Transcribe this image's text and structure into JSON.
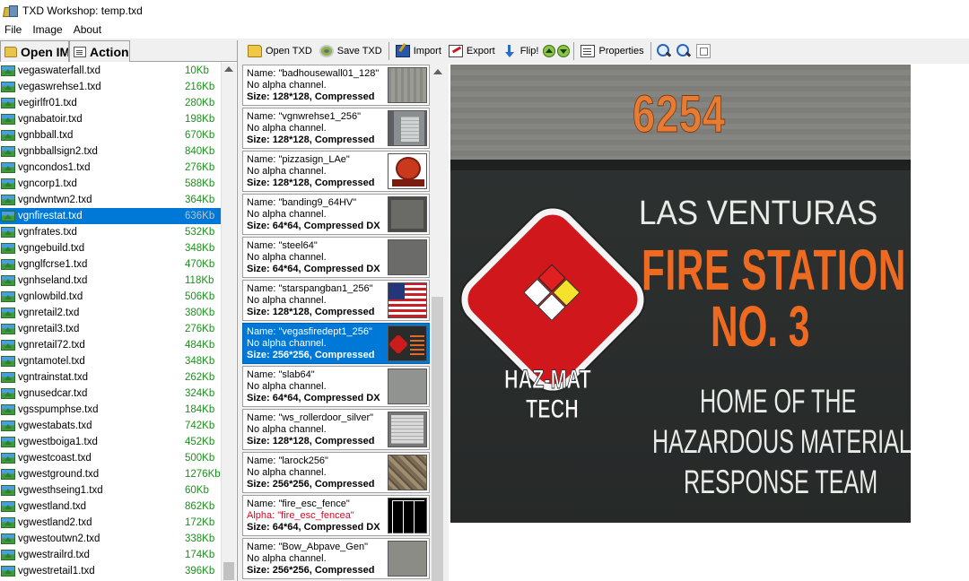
{
  "window": {
    "title": "TXD Workshop: temp.txd"
  },
  "menu": [
    "File",
    "Image",
    "About"
  ],
  "left_tabs": {
    "open": "Open IMG",
    "action": "Action"
  },
  "files": [
    {
      "name": "vegaswaterfall.txd",
      "size": "10Kb"
    },
    {
      "name": "vegaswrehse1.txd",
      "size": "216Kb"
    },
    {
      "name": "vegirlfr01.txd",
      "size": "280Kb"
    },
    {
      "name": "vgnabatoir.txd",
      "size": "198Kb"
    },
    {
      "name": "vgnbball.txd",
      "size": "670Kb"
    },
    {
      "name": "vgnbballsign2.txd",
      "size": "840Kb"
    },
    {
      "name": "vgncondos1.txd",
      "size": "276Kb"
    },
    {
      "name": "vgncorp1.txd",
      "size": "588Kb"
    },
    {
      "name": "vgndwntwn2.txd",
      "size": "364Kb"
    },
    {
      "name": "vgnfirestat.txd",
      "size": "636Kb"
    },
    {
      "name": "vgnfrates.txd",
      "size": "532Kb"
    },
    {
      "name": "vgngebuild.txd",
      "size": "348Kb"
    },
    {
      "name": "vgnglfcrse1.txd",
      "size": "470Kb"
    },
    {
      "name": "vgnhseland.txd",
      "size": "118Kb"
    },
    {
      "name": "vgnlowbild.txd",
      "size": "506Kb"
    },
    {
      "name": "vgnretail2.txd",
      "size": "380Kb"
    },
    {
      "name": "vgnretail3.txd",
      "size": "276Kb"
    },
    {
      "name": "vgnretail72.txd",
      "size": "484Kb"
    },
    {
      "name": "vgntamotel.txd",
      "size": "348Kb"
    },
    {
      "name": "vgntrainstat.txd",
      "size": "262Kb"
    },
    {
      "name": "vgnusedcar.txd",
      "size": "324Kb"
    },
    {
      "name": "vgsspumphse.txd",
      "size": "184Kb"
    },
    {
      "name": "vgwestabats.txd",
      "size": "742Kb"
    },
    {
      "name": "vgwestboiga1.txd",
      "size": "452Kb"
    },
    {
      "name": "vgwestcoast.txd",
      "size": "500Kb"
    },
    {
      "name": "vgwestground.txd",
      "size": "1276Kb"
    },
    {
      "name": "vgwesthseing1.txd",
      "size": "60Kb"
    },
    {
      "name": "vgwestland.txd",
      "size": "862Kb"
    },
    {
      "name": "vgwestland2.txd",
      "size": "172Kb"
    },
    {
      "name": "vgwestoutwn2.txd",
      "size": "338Kb"
    },
    {
      "name": "vgwestrailrd.txd",
      "size": "174Kb"
    },
    {
      "name": "vgwestretail1.txd",
      "size": "396Kb"
    }
  ],
  "selected_file_index": 9,
  "toolbar": {
    "open_txd": "Open TXD",
    "save_txd": "Save TXD",
    "import": "Import",
    "export": "Export",
    "flip": "Flip!",
    "properties": "Properties"
  },
  "textures": [
    {
      "name": "Name: \"badhousewall01_128\"",
      "alpha": "No alpha channel.",
      "size": "Size: 128*128, Compressed",
      "thumb": "t-concrete"
    },
    {
      "name": "Name: \"vgnwrehse1_256\"",
      "alpha": "No alpha channel.",
      "size": "Size: 128*128, Compressed",
      "thumb": "t-door"
    },
    {
      "name": "Name: \"pizzasign_LAe\"",
      "alpha": "No alpha channel.",
      "size": "Size: 128*128, Compressed",
      "thumb": "t-pizza"
    },
    {
      "name": "Name: \"banding9_64HV\"",
      "alpha": "No alpha channel.",
      "size": "Size: 64*64, Compressed DX",
      "thumb": "t-band"
    },
    {
      "name": "Name: \"steel64\"",
      "alpha": "No alpha channel.",
      "size": "Size: 64*64, Compressed DX",
      "thumb": "t-steel"
    },
    {
      "name": "Name: \"starspangban1_256\"",
      "alpha": "No alpha channel.",
      "size": "Size: 128*128, Compressed",
      "thumb": "t-flag"
    },
    {
      "name": "Name: \"vegasfiredept1_256\"",
      "alpha": "No alpha channel.",
      "size": "Size: 256*256, Compressed",
      "thumb": "t-vegas"
    },
    {
      "name": "Name: \"slab64\"",
      "alpha": "No alpha channel.",
      "size": "Size: 64*64, Compressed DX",
      "thumb": "t-slab"
    },
    {
      "name": "Name: \"ws_rollerdoor_silver\"",
      "alpha": "No alpha channel.",
      "size": "Size: 128*128, Compressed",
      "thumb": "t-roller"
    },
    {
      "name": "Name: \"larock256\"",
      "alpha": "No alpha channel.",
      "size": "Size: 256*256, Compressed",
      "thumb": "t-rock"
    },
    {
      "name": "Name: \"fire_esc_fence\"",
      "alpha": "Alpha: \"fire_esc_fencea\"",
      "size": "Size: 64*64, Compressed DX",
      "thumb": "t-fence",
      "alpha_red": true
    },
    {
      "name": "Name: \"Bow_Abpave_Gen\"",
      "alpha": "No alpha channel.",
      "size": "Size: 256*256, Compressed",
      "thumb": "t-pave"
    }
  ],
  "selected_texture_index": 6,
  "preview_sign": {
    "number": "6254",
    "line1": "LAS VENTURAS",
    "line2": "FIRE STATION",
    "line3": "NO. 3",
    "line4": "HOME OF THE",
    "line5": "HAZARDOUS MATERIALS",
    "line6": "RESPONSE TEAM",
    "badge_line1": "HAZ-MAT",
    "badge_line2": "TECH"
  },
  "colors": {
    "selection": "#0078d7",
    "file_size": "#179317",
    "alpha_warning": "#e8001c",
    "sign_orange": "#ee6a21",
    "badge_red": "#d0171b"
  }
}
